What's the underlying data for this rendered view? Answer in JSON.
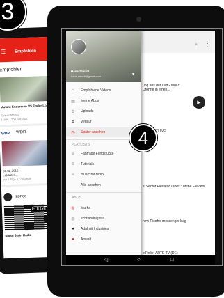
{
  "badges": {
    "step3": "3",
    "step4": "4"
  },
  "back_phone": {
    "tab_label": "Empfohlen",
    "section_title": "Empfohlen",
    "video1_title": "Mutant Enderman VS Ender Lord -",
    "video1_meta": "1 Jahr · 204 Tsd. Aufr.",
    "video1_channel": "SpatzoffWords",
    "channel_logo": "WDR",
    "channel_name": "WDR",
    "video2_date": "06.02.2015",
    "video2_title": "Lokalzeit...",
    "video2_meta": "vor 1 Tag · 177 Aufrufe",
    "channel2_name": "zpnce",
    "video3_label": "FOLGE 27",
    "video3_title": "Sloan Stain Radio"
  },
  "drawer": {
    "user_name": "Hans Stendt",
    "user_email": "hans.stendt@gmail.com",
    "items": [
      {
        "icon": "home-icon",
        "label": "Empfohlene Videos"
      },
      {
        "icon": "subscriptions-icon",
        "label": "Meine Abos"
      },
      {
        "icon": "upload-icon",
        "label": "Uploads"
      },
      {
        "icon": "history-icon",
        "label": "Verlauf"
      },
      {
        "icon": "watch-later-icon",
        "label": "Später ansehen"
      }
    ],
    "playlists_heading": "PLAYLISTS",
    "playlists": [
      "Fahrrade Fundstücke",
      "Tutorials",
      "music for radio",
      "Alle ansehen"
    ],
    "abos_heading": "ABOS",
    "abos": [
      "Marks",
      "echtlandnightfa",
      "Adafruit Industries",
      "Anwalt"
    ]
  },
  "feed": {
    "item1": "ung aus der Luft - Wie d Drohne in einen...",
    "item2": "KICK WITH US",
    "item3": "s' Secret Elevator Tapes : of the Elevator",
    "item4": "new Ricoh's messenger bag",
    "item5": "e Relief ARTE TV (DE)"
  },
  "colors": {
    "accent": "#e62117"
  }
}
